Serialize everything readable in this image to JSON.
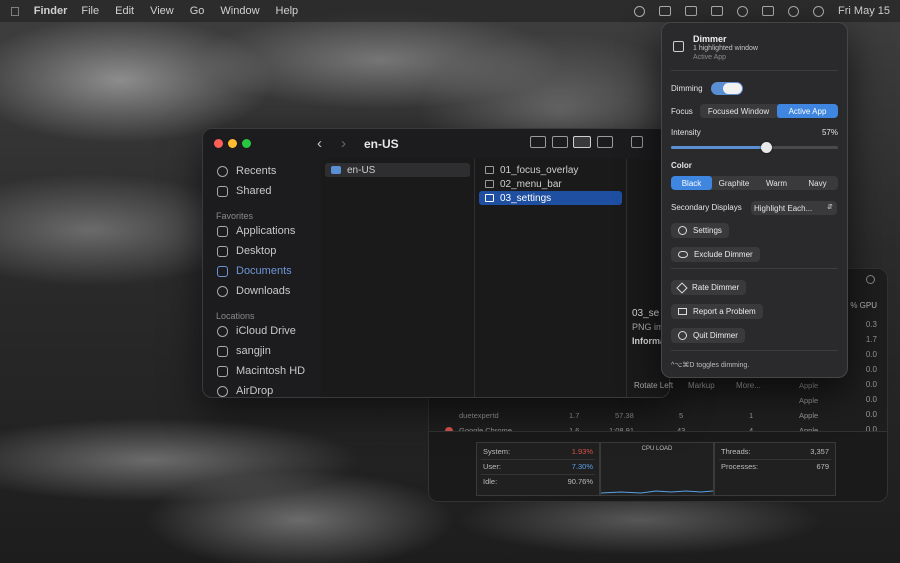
{
  "menubar": {
    "apple_icon": "apple-icon",
    "app_name": "Finder",
    "menus": [
      "File",
      "Edit",
      "View",
      "Go",
      "Window",
      "Help"
    ],
    "clock": "Fri May 15"
  },
  "finder": {
    "title": "en-US",
    "sidebar": {
      "top_items": [
        {
          "label": "Recents",
          "icon": "clock-icon"
        },
        {
          "label": "Shared",
          "icon": "shared-folder-icon"
        }
      ],
      "favorites_header": "Favorites",
      "favorites": [
        {
          "label": "Applications",
          "icon": "applications-icon"
        },
        {
          "label": "Desktop",
          "icon": "desktop-icon"
        },
        {
          "label": "Documents",
          "icon": "documents-icon"
        },
        {
          "label": "Downloads",
          "icon": "downloads-icon"
        }
      ],
      "locations_header": "Locations",
      "locations": [
        {
          "label": "iCloud Drive",
          "icon": "cloud-icon"
        },
        {
          "label": "sangjin",
          "icon": "home-icon"
        },
        {
          "label": "Macintosh HD",
          "icon": "disk-icon"
        },
        {
          "label": "AirDrop",
          "icon": "airdrop-icon"
        }
      ]
    },
    "column1": [
      "en-US"
    ],
    "column2": [
      "01_focus_overlay",
      "02_menu_bar",
      "03_settings"
    ]
  },
  "preview": {
    "name": "03_se",
    "kind": "PNG im",
    "info": "Informa",
    "actions": [
      "Rotate Left",
      "Markup",
      "More..."
    ]
  },
  "activity": {
    "gpu_header": "% GPU",
    "gpu_values": [
      "0.3",
      "1.7",
      "0.0",
      "0.0",
      "0.0",
      "0.0",
      "0.0",
      "0.0"
    ],
    "rows": [
      {
        "name": "",
        "cpu": "",
        "time": "",
        "threads": "",
        "ports": "",
        "user": "Apple"
      },
      {
        "name": "",
        "cpu": "",
        "time": "",
        "threads": "",
        "ports": "",
        "user": "Apple"
      },
      {
        "name": "duetexpertd",
        "cpu": "1.7",
        "time": "57.38",
        "threads": "5",
        "ports": "1",
        "user": "Apple"
      },
      {
        "name": "Google Chrome",
        "cpu": "1.6",
        "time": "1:08.91",
        "threads": "43",
        "ports": "4",
        "user": "Apple"
      }
    ],
    "summary": {
      "system_label": "System:",
      "system_value": "1.93%",
      "user_label": "User:",
      "user_value": "7.30%",
      "idle_label": "Idle:",
      "idle_value": "90.76%",
      "cpu_load_label": "CPU LOAD",
      "threads_label": "Threads:",
      "threads_value": "3,357",
      "processes_label": "Processes:",
      "processes_value": "679"
    },
    "colors": {
      "system": "#e0524a",
      "user": "#5aa0e6"
    }
  },
  "dimmer": {
    "title": "Dimmer",
    "subtitle": "1 highlighted window",
    "status": "Active App",
    "dimming_label": "Dimming",
    "dimming_on": true,
    "focus_label": "Focus",
    "focus_options": [
      "Focused Window",
      "Active App"
    ],
    "focus_selected": "Active App",
    "intensity_label": "Intensity",
    "intensity_value": "57%",
    "intensity_fraction": 0.57,
    "color_label": "Color",
    "color_options": [
      "Black",
      "Graphite",
      "Warm",
      "Navy"
    ],
    "color_selected": "Black",
    "secondary_label": "Secondary Displays",
    "secondary_value": "Highlight Each...",
    "settings_button": "Settings",
    "exclude_button": "Exclude Dimmer",
    "rate_button": "Rate Dimmer",
    "report_button": "Report a Problem",
    "quit_button": "Quit Dimmer",
    "hint": "^⌥⌘D toggles dimming.",
    "accent": "#3f86e0"
  }
}
